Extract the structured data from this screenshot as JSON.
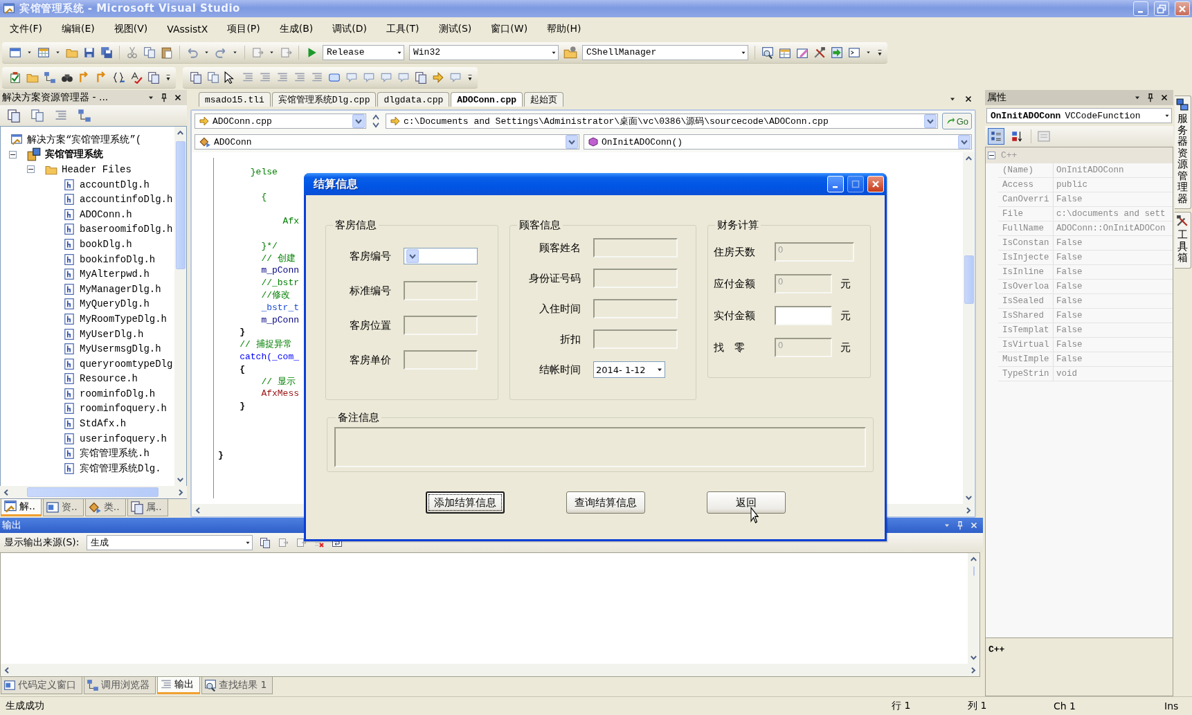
{
  "window": {
    "title": "宾馆管理系统 - Microsoft Visual Studio"
  },
  "menu": [
    "文件(F)",
    "编辑(E)",
    "视图(V)",
    "VAssistX",
    "项目(P)",
    "生成(B)",
    "调试(D)",
    "工具(T)",
    "测试(S)",
    "窗口(W)",
    "帮助(H)"
  ],
  "toolbar": {
    "configuration": "Release",
    "platform": "Win32",
    "class_combo": "CShellManager"
  },
  "solution_explorer": {
    "title": "解决方案资源管理器 - ...",
    "tree": [
      {
        "label": "解决方案“宾馆管理系统”(",
        "kind": "solution",
        "children": [
          {
            "label": "宾馆管理系统",
            "kind": "project",
            "expanded": true,
            "children": [
              {
                "label": "Header Files",
                "kind": "folder",
                "expanded": true,
                "children": [
                  {
                    "label": "accountDlg.h",
                    "kind": "file"
                  },
                  {
                    "label": "accountinfoDlg.h",
                    "kind": "file"
                  },
                  {
                    "label": "ADOConn.h",
                    "kind": "file"
                  },
                  {
                    "label": "baseroomifoDlg.h",
                    "kind": "file"
                  },
                  {
                    "label": "bookDlg.h",
                    "kind": "file"
                  },
                  {
                    "label": "bookinfoDlg.h",
                    "kind": "file"
                  },
                  {
                    "label": "MyAlterpwd.h",
                    "kind": "file"
                  },
                  {
                    "label": "MyManagerDlg.h",
                    "kind": "file"
                  },
                  {
                    "label": "MyQueryDlg.h",
                    "kind": "file"
                  },
                  {
                    "label": "MyRoomTypeDlg.h",
                    "kind": "file"
                  },
                  {
                    "label": "MyUserDlg.h",
                    "kind": "file"
                  },
                  {
                    "label": "MyUsermsgDlg.h",
                    "kind": "file"
                  },
                  {
                    "label": "queryroomtypeDlg",
                    "kind": "file"
                  },
                  {
                    "label": "Resource.h",
                    "kind": "file"
                  },
                  {
                    "label": "roominfoDlg.h",
                    "kind": "file"
                  },
                  {
                    "label": "roominfoquery.h",
                    "kind": "file"
                  },
                  {
                    "label": "StdAfx.h",
                    "kind": "file"
                  },
                  {
                    "label": "userinfoquery.h",
                    "kind": "file"
                  },
                  {
                    "label": "宾馆管理系统.h",
                    "kind": "file"
                  },
                  {
                    "label": "宾馆管理系统Dlg.",
                    "kind": "file"
                  }
                ]
              }
            ]
          }
        ]
      }
    ],
    "tabs": [
      {
        "label": "解..",
        "kind": "solution",
        "selected": true
      },
      {
        "label": "资..",
        "kind": "resource",
        "selected": false
      },
      {
        "label": "类..",
        "kind": "class",
        "selected": false
      },
      {
        "label": "属..",
        "kind": "property",
        "selected": false
      }
    ]
  },
  "editor": {
    "tabs": [
      {
        "label": "msado15.tli",
        "selected": false
      },
      {
        "label": "宾馆管理系统Dlg.cpp",
        "selected": false
      },
      {
        "label": "dlgdata.cpp",
        "selected": false
      },
      {
        "label": "ADOConn.cpp",
        "selected": true
      },
      {
        "label": "起始页",
        "selected": false
      }
    ],
    "file_combo": "ADOConn.cpp",
    "path": "c:\\Documents and Settings\\Administrator\\桌面\\vc\\0386\\源码\\sourcecode\\ADOConn.cpp",
    "go": "Go",
    "class_combo": "ADOConn",
    "member_combo": "OnInitADOConn()",
    "code": [
      {
        "kind": "comment",
        "text": "      }else"
      },
      {
        "kind": "blank"
      },
      {
        "kind": "comment",
        "text": "        {"
      },
      {
        "kind": "blank"
      },
      {
        "kind": "comment",
        "text": "            Afx"
      },
      {
        "kind": "blank"
      },
      {
        "kind": "comment",
        "text": "        }*/"
      },
      {
        "kind": "comment",
        "text": "        // 创建"
      },
      {
        "kind": "member",
        "text": "        m_pConn"
      },
      {
        "kind": "comment",
        "text": "        //_bstr"
      },
      {
        "kind": "comment",
        "text": "        //修改"
      },
      {
        "kind": "type",
        "text": "        _bstr_t"
      },
      {
        "kind": "member",
        "text": "        m_pConn"
      },
      {
        "kind": "plain",
        "text": "    }"
      },
      {
        "kind": "comment",
        "text": "    // 捕捉异常"
      },
      {
        "kind": "keyword",
        "text": "    catch(_com_"
      },
      {
        "kind": "plain",
        "text": "    {"
      },
      {
        "kind": "comment",
        "text": "        // 显示"
      },
      {
        "kind": "macro",
        "text": "        AfxMess"
      },
      {
        "kind": "plain",
        "text": "    }"
      },
      {
        "kind": "blank"
      },
      {
        "kind": "blank"
      },
      {
        "kind": "blank"
      },
      {
        "kind": "plain",
        "text": "}"
      }
    ]
  },
  "dialog": {
    "title": "结算信息",
    "groups": [
      {
        "title": "客房信息",
        "kind": "room",
        "fields": [
          {
            "label": "客房编号",
            "kind": "combo",
            "disabled": false
          },
          {
            "label": "标准编号",
            "kind": "text",
            "disabled": true
          },
          {
            "label": "客房位置",
            "kind": "text",
            "disabled": true
          },
          {
            "label": "客房单价",
            "kind": "text",
            "disabled": true
          }
        ]
      },
      {
        "title": "顾客信息",
        "kind": "guest",
        "fields": [
          {
            "label": "顾客姓名",
            "kind": "text",
            "disabled": true
          },
          {
            "label": "身份证号码",
            "kind": "text",
            "disabled": true
          },
          {
            "label": "入住时间",
            "kind": "text",
            "disabled": true
          },
          {
            "label": "折扣",
            "kind": "text",
            "disabled": true
          },
          {
            "label": "结帐时间",
            "kind": "date",
            "value": "2014- 1-12",
            "disabled": false
          }
        ]
      },
      {
        "title": "财务计算",
        "kind": "finance",
        "fields": [
          {
            "label": "住房天数",
            "kind": "text",
            "value": "0",
            "disabled": true
          },
          {
            "label": "应付金额",
            "kind": "text",
            "value": "0",
            "unit": "元",
            "disabled": true
          },
          {
            "label": "实付金额",
            "kind": "text",
            "unit": "元",
            "disabled": false
          },
          {
            "label": "找　零",
            "kind": "text",
            "value": "0",
            "unit": "元",
            "disabled": true
          }
        ]
      }
    ],
    "remarks": {
      "title": "备注信息",
      "disabled": true
    },
    "buttons": [
      {
        "label": "添加结算信息",
        "focused": true
      },
      {
        "label": "查询结算信息",
        "focused": false
      },
      {
        "label": "返回",
        "focused": false
      }
    ]
  },
  "properties": {
    "title": "属性",
    "object_name": "OnInitADOConn",
    "object_type": "VCCodeFunction",
    "view_buttons": [
      {
        "kind": "categorized",
        "selected": true
      },
      {
        "kind": "alphabetical",
        "selected": false
      }
    ],
    "category": {
      "label": "C++",
      "expanded": true
    },
    "rows": [
      {
        "name": "(Name)",
        "value": "OnInitADOConn"
      },
      {
        "name": "Access",
        "value": "public"
      },
      {
        "name": "CanOverri",
        "value": "False"
      },
      {
        "name": "File",
        "value": "c:\\documents and sett"
      },
      {
        "name": "FullName",
        "value": "ADOConn::OnInitADOCon"
      },
      {
        "name": "IsConstan",
        "value": "False"
      },
      {
        "name": "IsInjecte",
        "value": "False"
      },
      {
        "name": "IsInline",
        "value": "False"
      },
      {
        "name": "IsOverloa",
        "value": "False"
      },
      {
        "name": "IsSealed",
        "value": "False"
      },
      {
        "name": "IsShared",
        "value": "False"
      },
      {
        "name": "IsTemplat",
        "value": "False"
      },
      {
        "name": "IsVirtual",
        "value": "False"
      },
      {
        "name": "MustImple",
        "value": "False"
      },
      {
        "name": "TypeStrin",
        "value": "void"
      }
    ],
    "description": "C++"
  },
  "side_tabs": [
    {
      "label": "服务器资源管理器",
      "kind": "server"
    },
    {
      "label": "工具箱",
      "kind": "toolbox"
    }
  ],
  "output": {
    "title": "输出",
    "source_label": "显示输出来源(S):",
    "source": "生成",
    "tabs": [
      {
        "label": "代码定义窗口",
        "selected": false
      },
      {
        "label": "调用浏览器",
        "selected": false
      },
      {
        "label": "输出",
        "selected": true
      },
      {
        "label": "查找结果 1",
        "selected": false
      }
    ]
  },
  "status_bar": {
    "message": "生成成功",
    "line": "行 1",
    "column": "列 1",
    "char": "Ch 1",
    "mode": "Ins"
  }
}
